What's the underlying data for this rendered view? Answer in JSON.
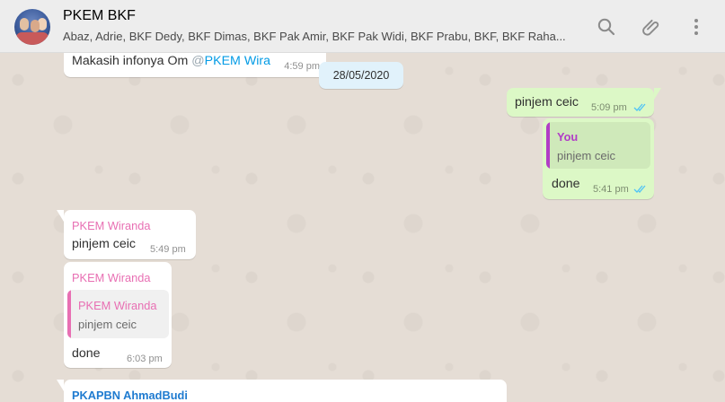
{
  "header": {
    "title": "PKEM BKF",
    "members": "Abaz, Adrie, BKF Dedy, BKF Dimas, BKF Pak Amir, BKF Pak Widi, BKF Prabu, BKF, BKF Raha...",
    "icons": {
      "search": "search-icon",
      "attach": "paperclip-icon",
      "menu": "menu-dots-icon"
    }
  },
  "colors": {
    "outgoing_bubble": "#dcf8c6",
    "incoming_bubble": "#ffffff",
    "read_ticks": "#4fc3f7",
    "sender_pink": "#e86fb3",
    "sender_blue": "#1f7bd0",
    "you_purple": "#b13dc6"
  },
  "messages": {
    "m1": {
      "text": "Makasih infonya Om ",
      "mention_at": "@",
      "mention_name": "PKEM Wira",
      "time": "4:59 pm"
    },
    "date_divider": "28/05/2020",
    "m2": {
      "text": "pinjem ceic",
      "time": "5:09 pm"
    },
    "m3": {
      "quote_sender": "You",
      "quote_text": "pinjem ceic",
      "text": "done",
      "time": "5:41 pm"
    },
    "m4": {
      "sender": "PKEM Wiranda",
      "text": "pinjem ceic",
      "time": "5:49 pm"
    },
    "m5": {
      "sender": "PKEM Wiranda",
      "quote_sender": "PKEM Wiranda",
      "quote_text": "pinjem ceic",
      "text": "done",
      "time": "6:03 pm"
    },
    "m6": {
      "sender": "PKAPBN AhmadBudi"
    }
  }
}
